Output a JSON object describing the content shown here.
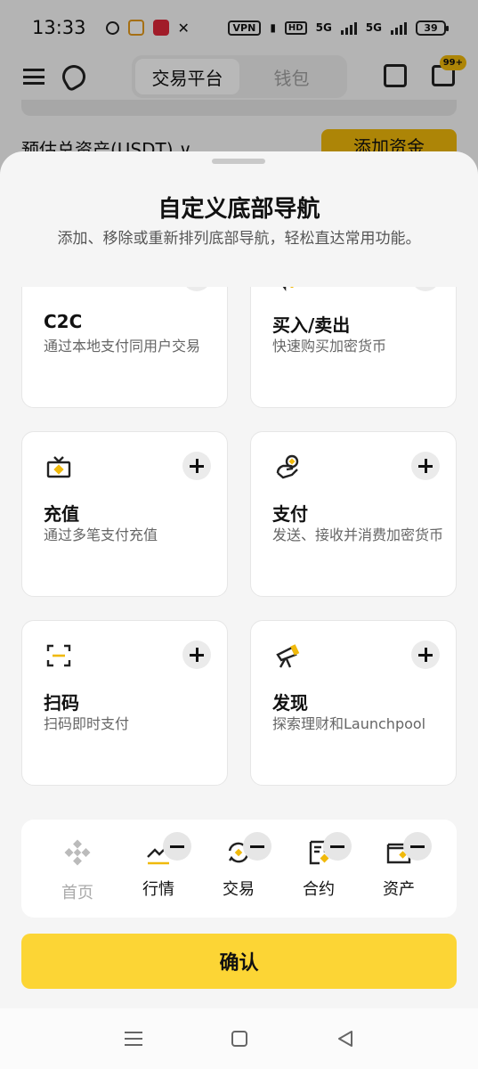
{
  "status_bar": {
    "time": "13:33",
    "vpn": "VPN",
    "hd": "HD",
    "net1": "5G",
    "net2": "5G",
    "battery": "39"
  },
  "app_header": {
    "tabs": [
      "交易平台",
      "钱包"
    ],
    "active_tab": 0,
    "badge": "99+",
    "assets_label": "预估总资产(USDT) ∨",
    "add_funds": "添加资金"
  },
  "sheet": {
    "title": "自定义底部导航",
    "subtitle": "添加、移除或重新排列底部导航，轻松直达常用功能。",
    "cards": [
      {
        "title": "C2C",
        "desc": "通过本地支付同用户交易",
        "icon": "users-icon"
      },
      {
        "title": "买入/卖出",
        "desc": "快速购买加密货币",
        "icon": "buy-sell-icon"
      },
      {
        "title": "充值",
        "desc": "通过多笔支付充值",
        "icon": "deposit-icon"
      },
      {
        "title": "支付",
        "desc": "发送、接收并消费加密货币",
        "icon": "pay-icon"
      },
      {
        "title": "扫码",
        "desc": "扫码即时支付",
        "icon": "scan-icon"
      },
      {
        "title": "发现",
        "desc": "探索理财和Launchpool",
        "icon": "telescope-icon"
      }
    ],
    "dock": [
      {
        "label": "首页",
        "icon": "home-icon",
        "removable": false
      },
      {
        "label": "行情",
        "icon": "markets-icon",
        "removable": true
      },
      {
        "label": "交易",
        "icon": "trade-icon",
        "removable": true
      },
      {
        "label": "合约",
        "icon": "futures-icon",
        "removable": true
      },
      {
        "label": "资产",
        "icon": "wallet-icon",
        "removable": true
      }
    ],
    "confirm": "确认"
  },
  "colors": {
    "accent": "#fcd535",
    "brand": "#f0b90b"
  }
}
